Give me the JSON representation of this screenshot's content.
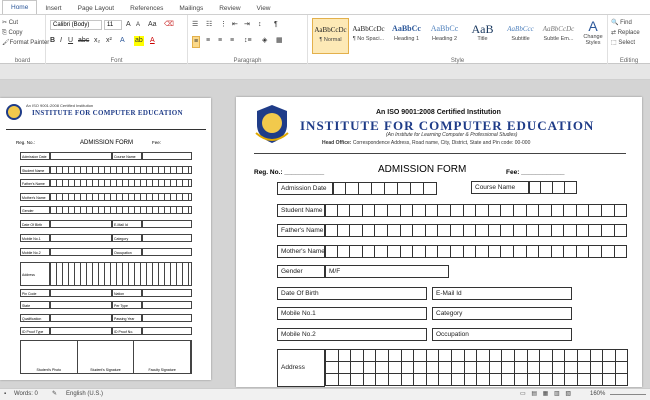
{
  "tabs": [
    "Home",
    "Insert",
    "Page Layout",
    "References",
    "Mailings",
    "Review",
    "View"
  ],
  "clipboard": {
    "cut": "Cut",
    "copy": "Copy",
    "painter": "Format Painter",
    "label": "board"
  },
  "font": {
    "name": "Calibri (Body)",
    "size": "11",
    "label": "Font"
  },
  "paragraph": {
    "label": "Paragraph"
  },
  "styles": {
    "items": [
      {
        "preview": "AaBbCcDc",
        "name": "¶ Normal"
      },
      {
        "preview": "AaBbCcDc",
        "name": "¶ No Spaci..."
      },
      {
        "preview": "AaBbCc",
        "name": "Heading 1"
      },
      {
        "preview": "AaBbCc",
        "name": "Heading 2"
      },
      {
        "preview": "AaB",
        "name": "Title"
      },
      {
        "preview": "AaBbCcc",
        "name": "Subtitle"
      },
      {
        "preview": "AaBbCcDc",
        "name": "Subtle Em..."
      }
    ],
    "change": "Change Styles",
    "label": "Style"
  },
  "editing": {
    "find": "Find",
    "replace": "Replace",
    "select": "Select",
    "label": "Editing"
  },
  "doc": {
    "iso": "An ISO 9001:2008 Certified Institution",
    "title": "INSTITUTE FOR COMPUTER EDUCATION",
    "subtitle": "(An Institute for Learning Computer & Professional Studies)",
    "head_office_label": "Head Office:",
    "head_office": "Correspondence Address, Road name, City, District, State and Pin code: 00-000",
    "reg_no": "Reg. No.: ___________",
    "fee": "Fee: ____________",
    "form_title": "ADMISSION FORM",
    "fields": {
      "admission_date": "Admission Date",
      "course_name": "Course Name",
      "student_name": "Student Name",
      "father_name": "Father's Name",
      "mother_name": "Mother's Name",
      "gender": "Gender",
      "gender_opt": "M/F",
      "dob": "Date Of Birth",
      "email": "E-Mail Id",
      "mobile1": "Mobile No.1",
      "category": "Category",
      "mobile2": "Mobile No.2",
      "occupation": "Occupation",
      "address": "Address"
    }
  },
  "thumb": {
    "iso": "An ISO 9001:2008 Certified Institution",
    "title": "INSTITUTE FOR COMPUTER EDUCATION",
    "reg": "Reg. No.:",
    "fee": "Fee:",
    "form_title": "ADMISSION FORM",
    "rows": [
      "Admission Date",
      "Student Name",
      "Father's Name",
      "Mother's Name",
      "Gender",
      "Date Of Birth",
      "Mobile No.1",
      "Mobile No.2",
      "Address",
      "Pin Code",
      "State",
      "Qualification",
      "ID Proof Type"
    ],
    "right_rows": {
      "r0": "Course Name",
      "r5": "E-Mail Id",
      "r6": "Category",
      "r7": "Occupation",
      "r9": "Nation",
      "r10": "Per Type",
      "r11": "Passing Year",
      "r12": "ID Proof No."
    },
    "sig": [
      "Student's Photo",
      "Student's Signature",
      "Faculty Signature"
    ]
  },
  "status": {
    "words": "Words: 0",
    "lang": "English (U.S.)",
    "zoom": "160%"
  }
}
